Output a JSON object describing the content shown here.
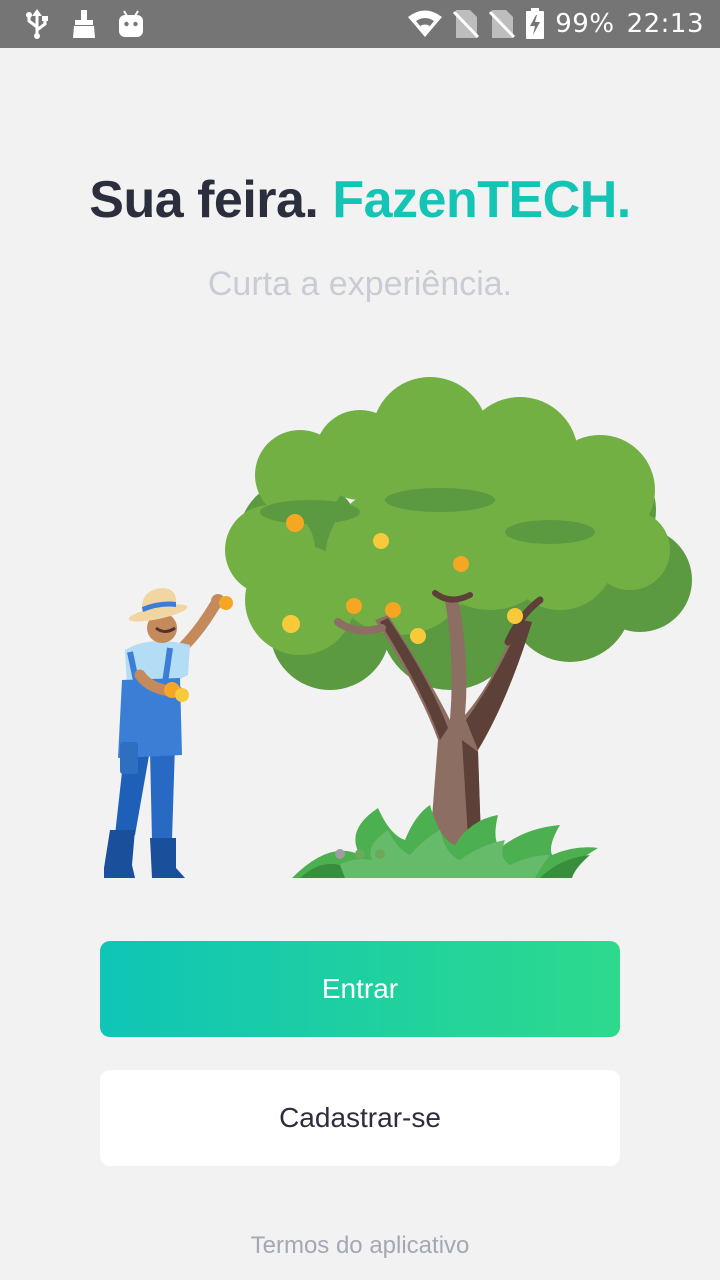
{
  "status_bar": {
    "battery_percent": "99%",
    "time": "22:13",
    "icons_left": [
      "usb-icon",
      "cleaner-icon",
      "android-icon"
    ],
    "icons_right": [
      "wifi-icon",
      "sim-off-icon",
      "sim-off-icon",
      "battery-charging-icon"
    ]
  },
  "headline": {
    "part1": "Sua feira.",
    "part2": "FazenTECH."
  },
  "subtitle": "Curta a experiência.",
  "buttons": {
    "login": "Entrar",
    "signup": "Cadastrar-se"
  },
  "terms": "Termos do aplicativo",
  "colors": {
    "accent": "#14c4b4",
    "gradient_start": "#0fc5b6",
    "gradient_end": "#2dda8c",
    "title": "#2b2f3d",
    "status_bar": "#757575"
  },
  "carousel": {
    "page_count": 3,
    "active_index": 0
  }
}
